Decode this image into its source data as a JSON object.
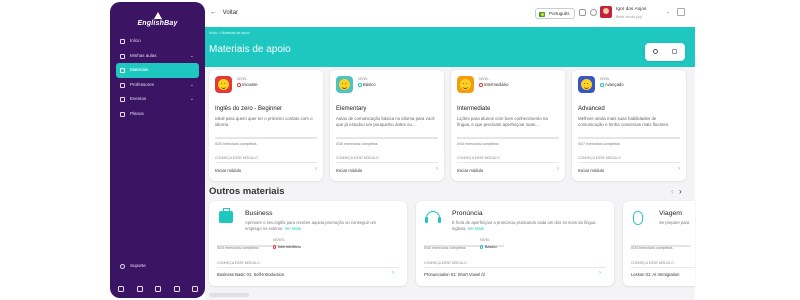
{
  "sidebar": {
    "logo": "EnglishBay",
    "items": [
      {
        "label": "Início",
        "icon": "home-icon"
      },
      {
        "label": "Minhas aulas",
        "icon": "book-icon"
      },
      {
        "label": "Materiais",
        "icon": "folder-icon"
      },
      {
        "label": "Professores",
        "icon": "people-icon"
      },
      {
        "label": "Eventos",
        "icon": "calendar-icon"
      },
      {
        "label": "Planos",
        "icon": "plan-icon"
      }
    ],
    "support": "Suporte",
    "socials": [
      "facebook-icon",
      "instagram-icon",
      "twitter-icon",
      "youtube-icon",
      "linkedin-icon"
    ]
  },
  "topbar": {
    "back_label": "Voltar",
    "language": "Português",
    "user_name": "Igor dos Anjos",
    "user_welcome": "Bem vindo (a)!"
  },
  "banner": {
    "breadcrumb": "Início > Materiais de apoio",
    "title": "Materiais de apoio"
  },
  "modules": [
    {
      "level_label": "NÍVEL",
      "level": "Iniciante",
      "badge_color": "#e53935",
      "title": "Inglês do zero - Beginner",
      "description": "Ideal para quem quer ter o primeiro contato com o idioma.",
      "count": "0/20 exercícios completos",
      "know": "CONHEÇA ESSE MÓDULO",
      "start": "Iniciar módulo"
    },
    {
      "level_label": "NÍVEL",
      "level": "Básico",
      "badge_color": "#4fc3c0",
      "title": "Elementary",
      "description": "Aulas de comunicação básica no idioma para você que já estudou um pouquinho antes ou...",
      "count": "0/35 exercícios completos",
      "know": "CONHEÇA ESSE MÓDULO",
      "start": "Iniciar módulo"
    },
    {
      "level_label": "NÍVEL",
      "level": "Intermediário",
      "badge_color": "#f39c12",
      "title": "Intermediate",
      "description": "Lições para alunos com bom conhecimento na língua, e que precisam aperfeiçoar suas...",
      "count": "0/44 exercícios completos",
      "know": "CONHEÇA ESSE MÓDULO",
      "start": "Iniciar módulo"
    },
    {
      "level_label": "NÍVEL",
      "level": "Avançado",
      "badge_color": "#3957c4",
      "title": "Advanced",
      "description": "Melhore ainda mais suas habilidades de comunicação e tenha conversas mais fluentes.",
      "count": "0/27 exercícios completos",
      "know": "CONHEÇA ESSE MÓDULO",
      "start": "Iniciar módulo"
    }
  ],
  "other": {
    "title": "Outros materiais",
    "cards": [
      {
        "title": "Business",
        "description_1": "Aprimore o seu inglês para receber aquela promoção ou conseguir um",
        "description_2": "emprego no exterior.",
        "more": "Ver Mais",
        "count": "0/24 exercícios completos",
        "level_label": "NÍVEIS",
        "level": "Intermediário",
        "know": "CONHEÇA ESSE MÓDULO",
        "start": "Business Basic 01: Self-Introduction"
      },
      {
        "title": "Pronúncia",
        "description_1": "É hora de aperfeiçoar a pronúncia praticando cada um dos 44 sons da língua",
        "description_2": "inglesa.",
        "more": "Ver Mais",
        "count": "0/44 exercícios completos",
        "level_label": "NÍVEL",
        "level": "Básico",
        "know": "CONHEÇA ESSE MÓDULO",
        "start": "Pronunciation 01: Short Vowel /ɪ/"
      },
      {
        "title": "Viagem",
        "description_1": "Se prepare para",
        "description_2": "",
        "more": "",
        "count": "0/24 exercícios completos",
        "level_label": "",
        "level": "",
        "know": "CONHEÇA ESSE MÓDULO",
        "start": "Lesson 01: At Immigration"
      }
    ]
  }
}
